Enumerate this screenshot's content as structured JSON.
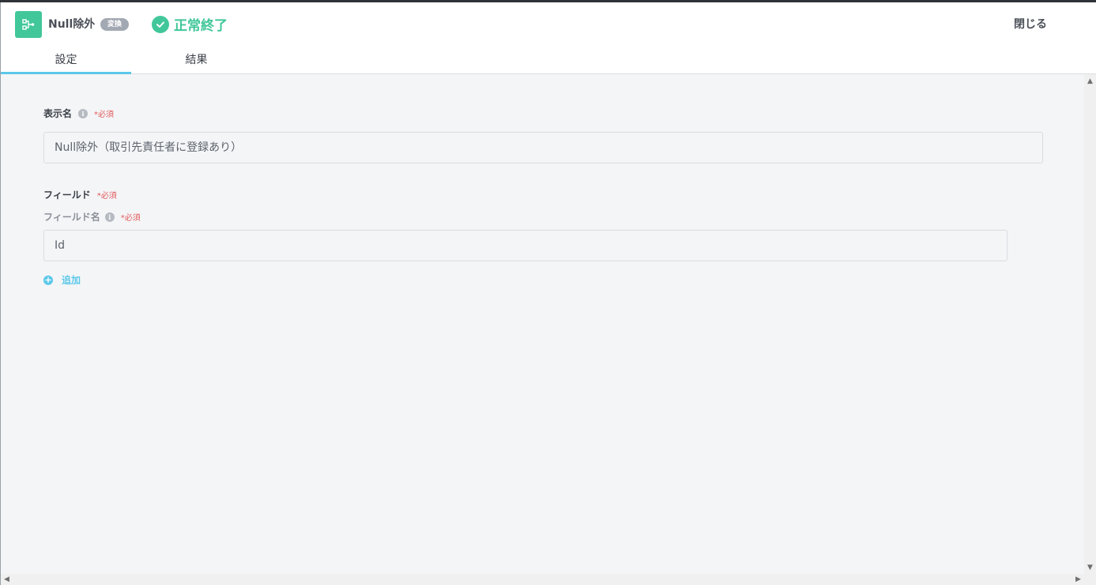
{
  "header": {
    "node_title": "Null除外",
    "node_badge": "変換",
    "status_text": "正常終了",
    "close_label": "閉じる"
  },
  "tabs": [
    {
      "label": "設定",
      "active": true
    },
    {
      "label": "結果",
      "active": false
    }
  ],
  "form": {
    "display_name": {
      "label": "表示名",
      "required": "*必須",
      "value": "Null除外（取引先責任者に登録あり）"
    },
    "fields": {
      "label": "フィールド",
      "required": "*必須",
      "field_name": {
        "label": "フィールド名",
        "required": "*必須",
        "value": "Id"
      }
    },
    "add_label": "追加"
  },
  "colors": {
    "accent_green": "#41c79a",
    "accent_blue": "#5bc8ea",
    "required_red": "#e25b5b"
  },
  "icons": {
    "node": "flow-node-icon",
    "status": "check-circle-icon",
    "info": "info-icon",
    "add": "plus-circle-icon"
  }
}
